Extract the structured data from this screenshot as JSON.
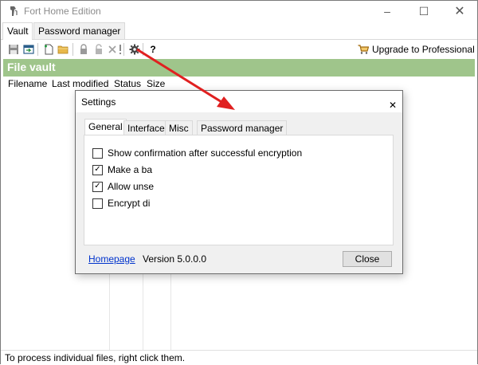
{
  "window": {
    "title": "Fort Home Edition",
    "controls": {
      "minimize": "–",
      "maximize": "☐",
      "close": "✕"
    }
  },
  "tabs": [
    {
      "label": "Vault",
      "active": true
    },
    {
      "label": "Password manager",
      "active": false
    }
  ],
  "toolbar": {
    "icons": [
      "save-icon",
      "open-vault-icon",
      "new-file-icon",
      "folder-icon",
      "lock-icon",
      "unlock-icon",
      "delete-icon",
      "more-icon",
      "settings-icon",
      "help-icon"
    ],
    "help_label": "?",
    "upgrade_label": "Upgrade to Professional"
  },
  "vault": {
    "header": "File vault",
    "header_color": "#9fc58b",
    "columns": [
      "Filename",
      "Last modified",
      "Status",
      "Size"
    ]
  },
  "statusbar": {
    "text": "To process individual files, right click them."
  },
  "settings_dialog": {
    "title": "Settings",
    "close_glyph": "✕",
    "tabs": [
      {
        "label": "General",
        "active": true
      },
      {
        "label": "Interface",
        "active": false
      },
      {
        "label": "Misc",
        "active": false
      },
      {
        "label": "Password manager",
        "active": false
      }
    ],
    "options": [
      {
        "label": "Show confirmation after successful encryption",
        "checked": false
      },
      {
        "label": "Make a ba",
        "checked": true
      },
      {
        "label": "Allow unse",
        "checked": true
      },
      {
        "label": "Encrypt di",
        "checked": false
      }
    ],
    "homepage_link": "Homepage",
    "version": "Version 5.0.0.0",
    "close_button": "Close"
  },
  "annotation_arrow": {
    "color": "#e02020"
  }
}
